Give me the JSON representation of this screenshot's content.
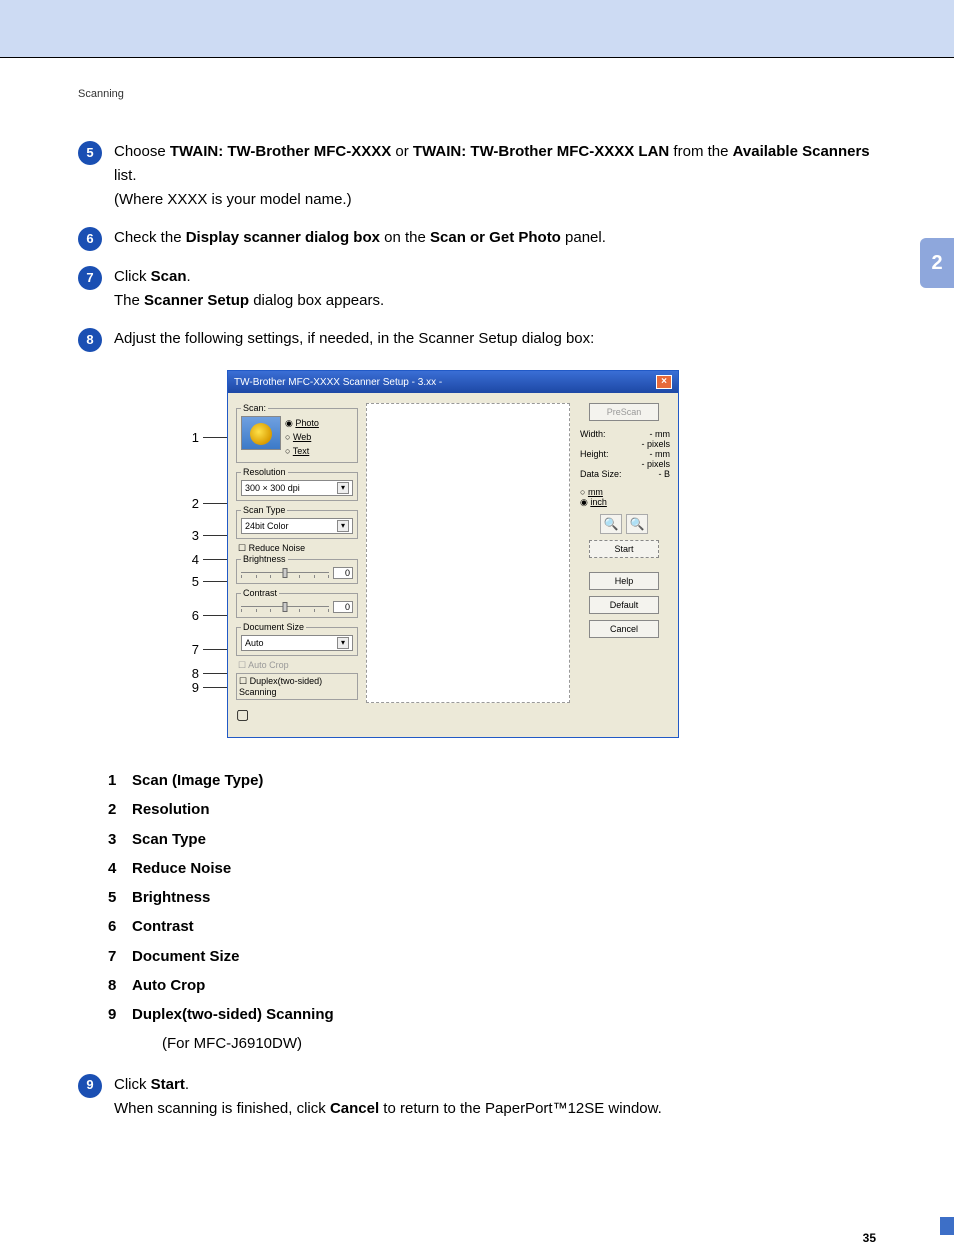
{
  "breadcrumb": "Scanning",
  "chapter": "2",
  "page_number": "35",
  "steps": {
    "5": {
      "p1a": "Choose ",
      "b1": "TWAIN: TW-Brother MFC-XXXX",
      "p1b": " or ",
      "b2": "TWAIN: TW-Brother MFC-XXXX LAN",
      "p1c": " from the ",
      "b3": "Available Scanners",
      "p1d": " list.",
      "p2": "(Where XXXX is your model name.)"
    },
    "6": {
      "a": "Check the ",
      "b1": "Display scanner dialog box",
      "m": " on the ",
      "b2": "Scan or Get Photo",
      "e": " panel."
    },
    "7": {
      "a": "Click ",
      "b1": "Scan",
      "e": ".",
      "p2a": "The ",
      "p2b": "Scanner Setup",
      "p2c": " dialog box appears."
    },
    "8": {
      "text": "Adjust the following settings, if needed, in the Scanner Setup dialog box:"
    },
    "9": {
      "a": "Click ",
      "b1": "Start",
      "e": ".",
      "p2a": "When scanning is finished, click ",
      "p2b": "Cancel",
      "p2c": " to return to the PaperPort™12SE window."
    }
  },
  "dialog": {
    "title": "TW-Brother MFC-XXXX   Scanner Setup - 3.xx -",
    "scan_legend": "Scan:",
    "radios": {
      "photo": "Photo",
      "web": "Web",
      "text": "Text"
    },
    "resolution_legend": "Resolution",
    "resolution_value": "300 × 300 dpi",
    "scantype_legend": "Scan Type",
    "scantype_value": "24bit Color",
    "reduce_noise": "Reduce Noise",
    "brightness_legend": "Brightness",
    "brightness_value": "0",
    "contrast_legend": "Contrast",
    "contrast_value": "0",
    "docsize_legend": "Document Size",
    "docsize_value": "Auto",
    "autocrop": "Auto Crop",
    "duplex": "Duplex(two-sided) Scanning",
    "btn_prescan": "PreScan",
    "btn_start": "Start",
    "btn_help": "Help",
    "btn_default": "Default",
    "btn_cancel": "Cancel",
    "info_width": "Width:",
    "info_height": "Height:",
    "info_ds": "Data Size:",
    "mm": "- mm",
    "px": "- pixels",
    "b": "- B",
    "unit_mm": "mm",
    "unit_inch": "inch"
  },
  "callouts": [
    "1",
    "2",
    "3",
    "4",
    "5",
    "6",
    "7",
    "8",
    "9"
  ],
  "legend": [
    "Scan (Image Type)",
    "Resolution",
    "Scan Type",
    "Reduce Noise",
    "Brightness",
    "Contrast",
    "Document Size",
    "Auto Crop",
    "Duplex(two-sided) Scanning"
  ],
  "legend_note": "(For MFC-J6910DW)"
}
